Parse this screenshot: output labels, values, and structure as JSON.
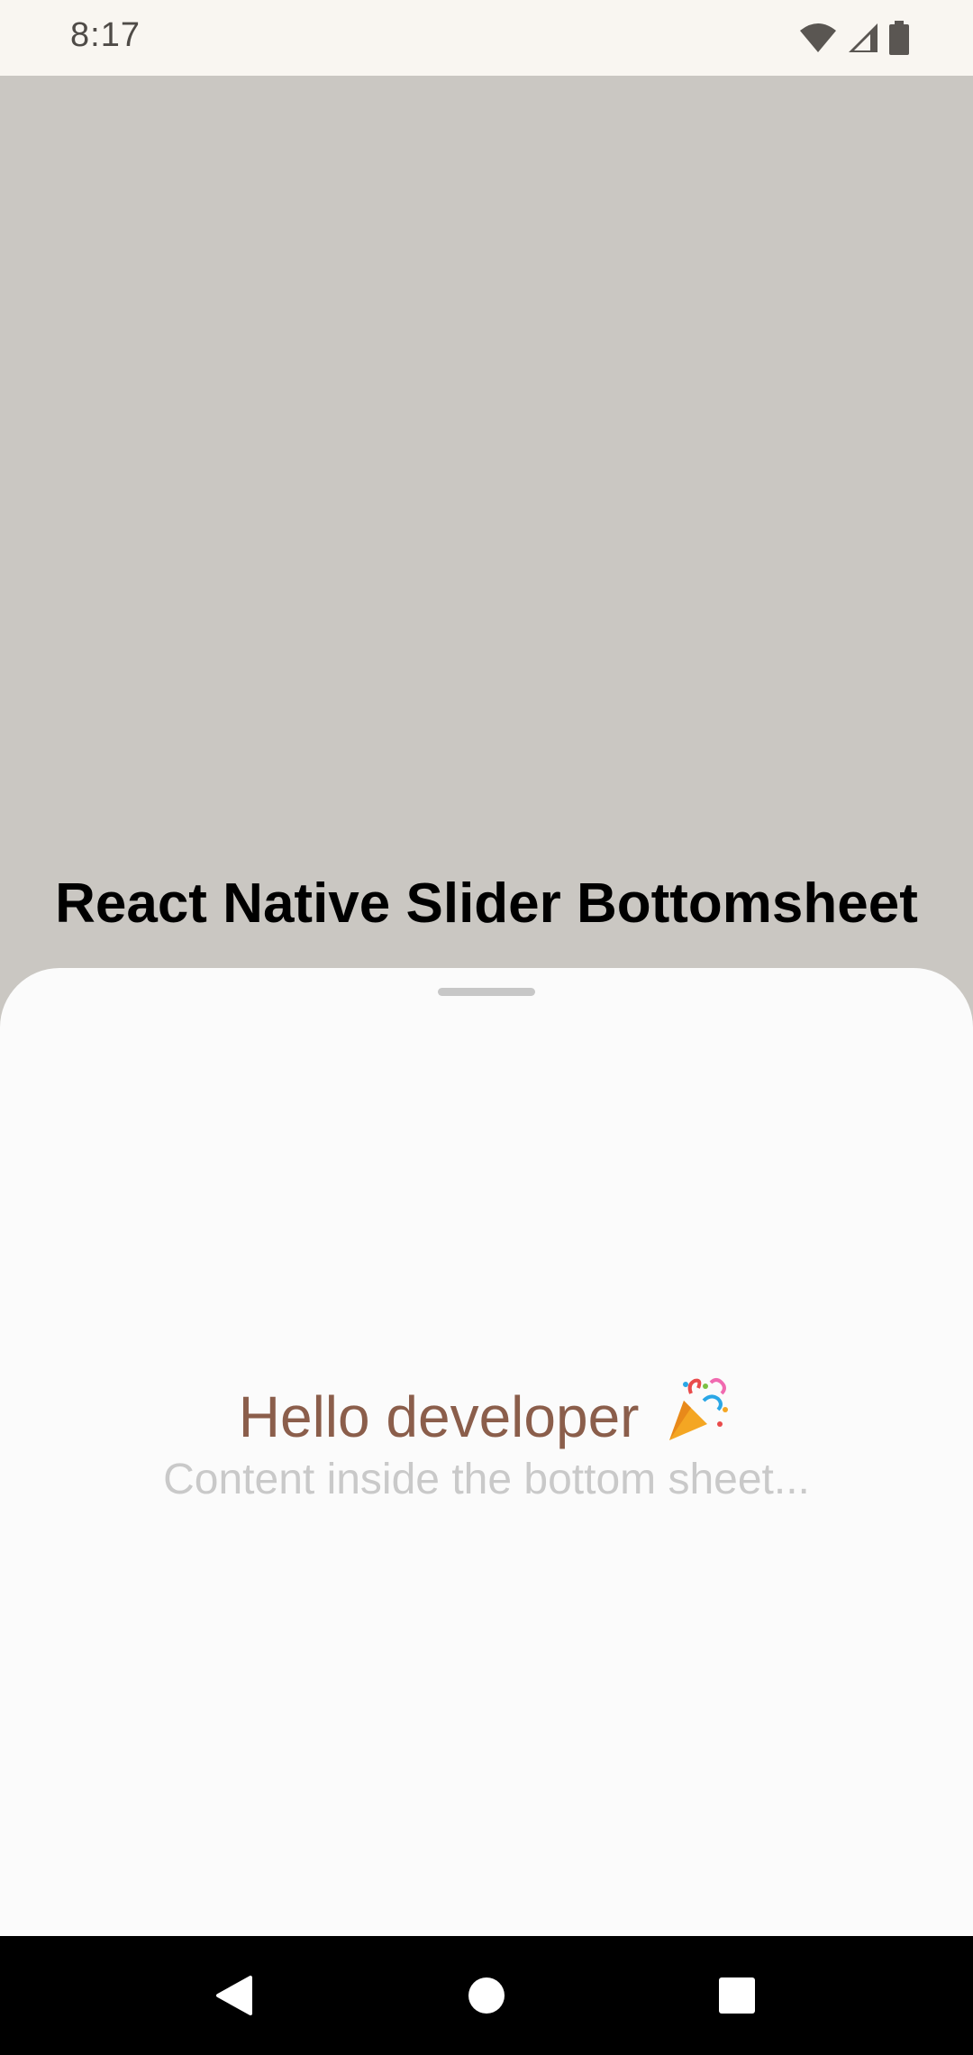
{
  "status_bar": {
    "time": "8:17",
    "icons": [
      "wifi-icon",
      "cellular-signal-icon",
      "battery-icon"
    ]
  },
  "main": {
    "title": "React Native Slider Bottomsheet"
  },
  "bottom_sheet": {
    "heading": "Hello developer",
    "heading_icon": "party-popper-icon",
    "subtext": "Content inside the bottom sheet..."
  },
  "nav_bar": {
    "buttons": [
      "back-icon",
      "home-icon",
      "recents-icon"
    ]
  },
  "colors": {
    "backdrop": "#cac7c2",
    "sheet": "#fbfbfb",
    "heading": "#8b5e4b",
    "subtext": "#c9c9c9",
    "status_bar": "#f9f6f1"
  }
}
